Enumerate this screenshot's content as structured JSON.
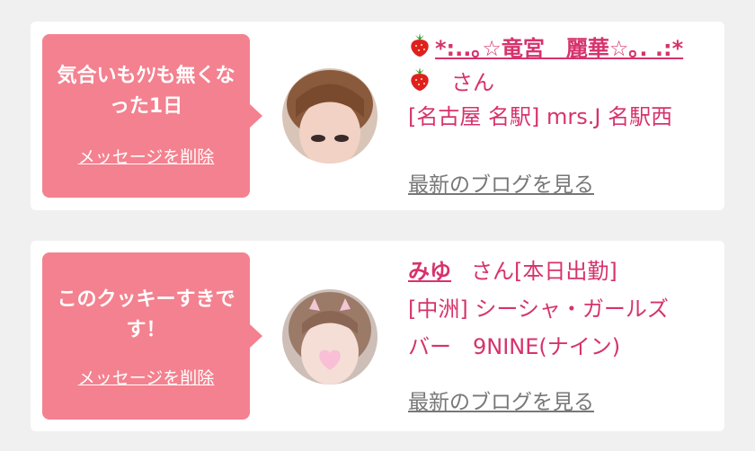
{
  "colors": {
    "background": "#f0f0f0",
    "bubble": "#f4818f",
    "accent_text": "#d6336c",
    "link_gray": "#777777"
  },
  "cards": [
    {
      "message": "気合いもｸｿも無くなった1日",
      "delete_label": "メッセージを削除",
      "avatar_icon": "avatar-photo",
      "name_line": "*:..｡☆竜宮　麗華☆｡. .:*",
      "name_suffix": "さん",
      "shop": "[名古屋 名駅] mrs.J 名駅西",
      "blog_label": "最新のブログを見る"
    },
    {
      "message": "このクッキーすきです！",
      "delete_label": "メッセージを削除",
      "avatar_icon": "avatar-photo",
      "name": "みゆ",
      "name_suffix": "さん[本日出勤]",
      "shop_line1": "[中洲] シーシャ・ガールズ",
      "shop_line2": "バー　9NINE(ナイン)",
      "blog_label": "最新のブログを見る"
    }
  ]
}
